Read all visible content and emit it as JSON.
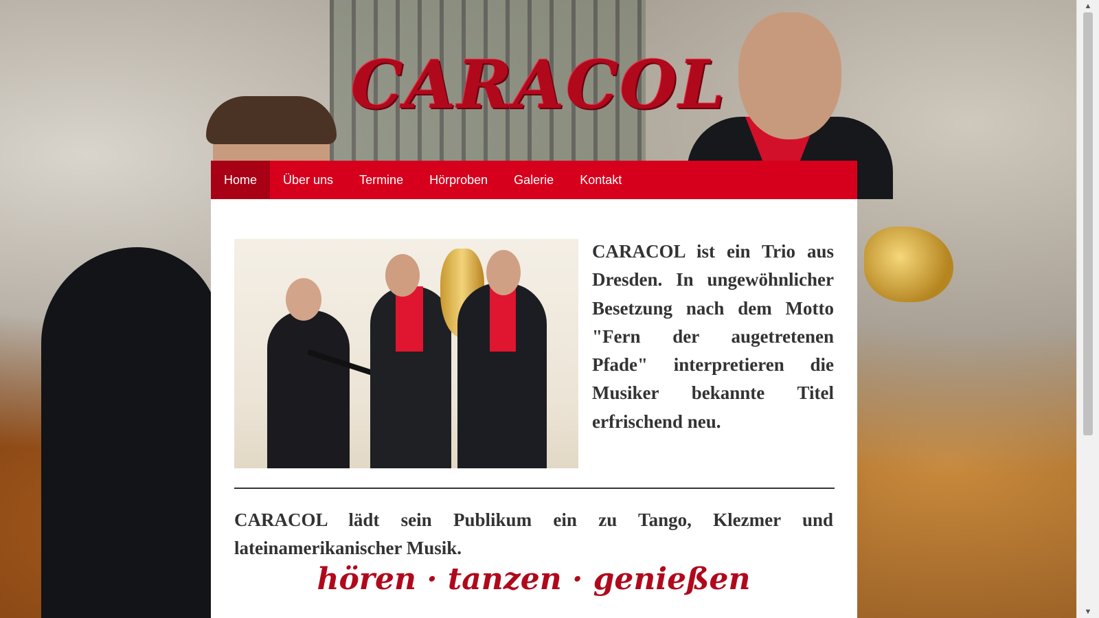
{
  "site": {
    "logo_text": "CARACOL"
  },
  "nav": {
    "items": [
      {
        "label": "Home",
        "active": true
      },
      {
        "label": "Über uns",
        "active": false
      },
      {
        "label": "Termine",
        "active": false
      },
      {
        "label": "Hörproben",
        "active": false
      },
      {
        "label": "Galerie",
        "active": false
      },
      {
        "label": "Kontakt",
        "active": false
      }
    ]
  },
  "content": {
    "intro": "CARACOL ist ein Trio aus Dresden. In ungewöhnlicher Besetzung nach dem Motto \"Fern der augetretenen Pfade\" interpretieren die Musiker bekannte Titel erfrischend neu.",
    "lead": "CARACOL lädt sein Publikum ein zu Tango, Klezmer und lateinamerikanischer Musik.",
    "slogan": "hören · tanzen · genießen"
  },
  "colors": {
    "brand_red": "#d7001c",
    "nav_active": "#a80015",
    "logo_red": "#b0091c",
    "text": "#333333"
  },
  "icons": {
    "scroll_up": "▲",
    "scroll_down": "▼"
  }
}
